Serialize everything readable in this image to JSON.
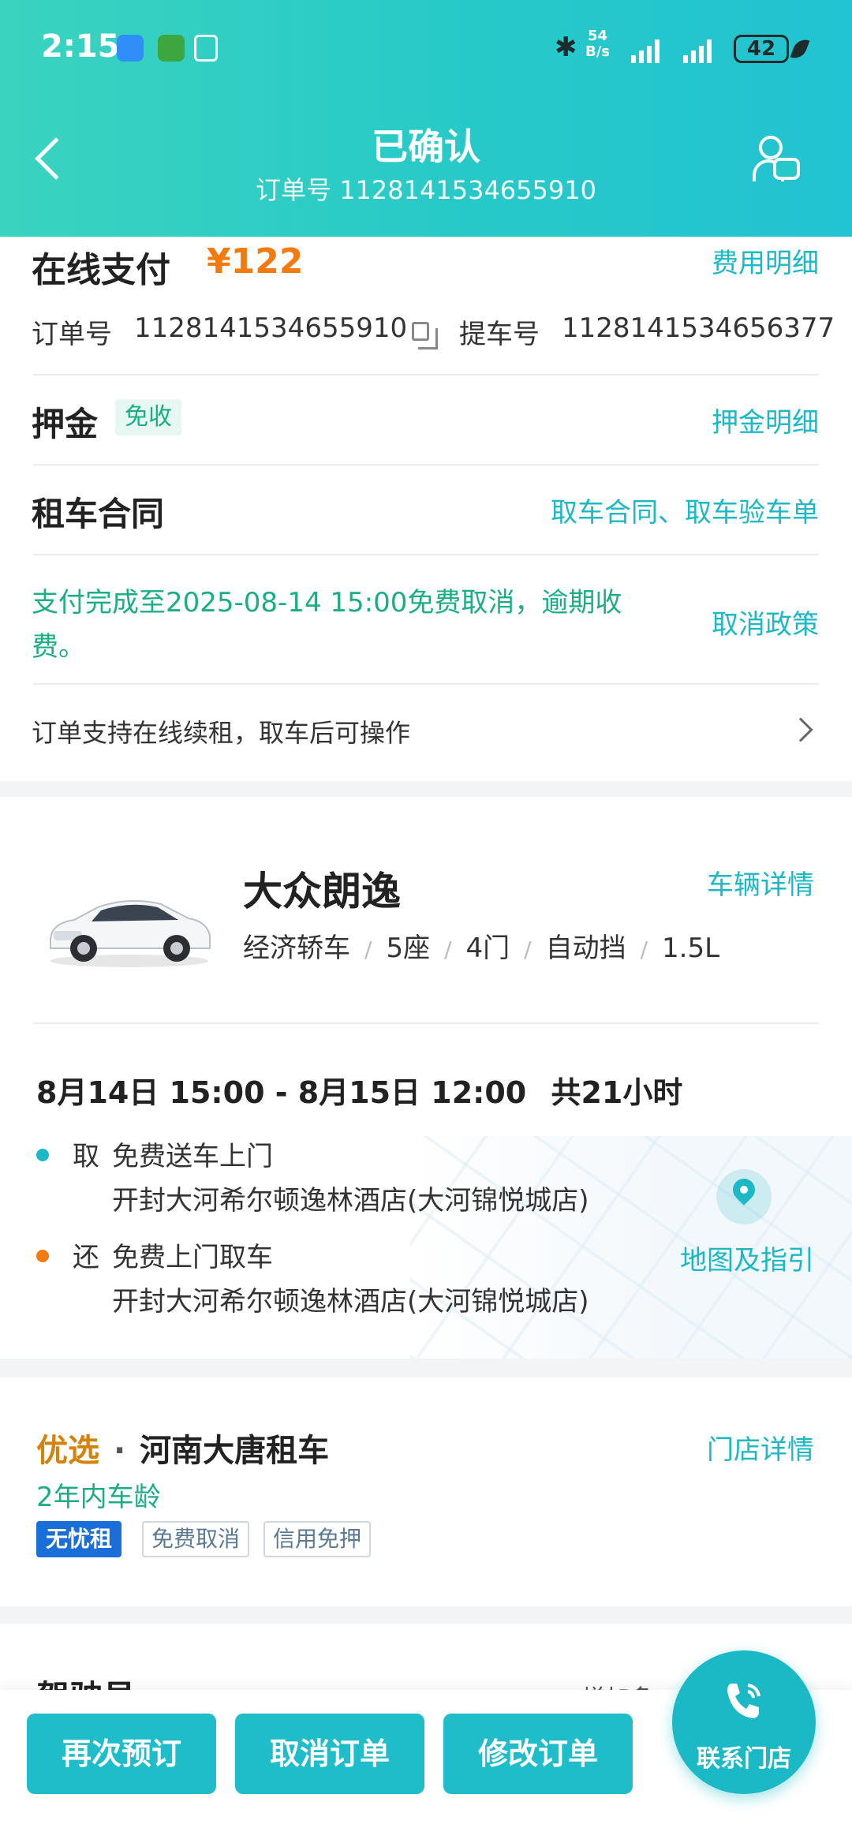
{
  "status_bar": {
    "time": "2:15",
    "net_speed_value": "54",
    "net_speed_unit": "B/s",
    "battery": "42"
  },
  "header": {
    "title": "已确认",
    "subtitle": "订单号 1128141534655910"
  },
  "payment": {
    "label": "在线支付",
    "amount": "¥122",
    "fee_detail_link": "费用明细",
    "order_no_label": "订单号",
    "order_no": "1128141534655910",
    "pickup_no_label": "提车号",
    "pickup_no": "1128141534656377",
    "deposit_label": "押金",
    "deposit_badge": "免收",
    "deposit_detail_link": "押金明细",
    "contract_label": "租车合同",
    "contract_link": "取车合同、取车验车单",
    "cancel_notice_line1": "支付完成至2025-08-14 15:00免费取消，逾期收",
    "cancel_notice_line2": "费。",
    "cancel_policy_link": "取消政策",
    "renew_text": "订单支持在线续租，取车后可操作"
  },
  "car": {
    "name": "大众朗逸",
    "detail_link": "车辆详情",
    "specs": [
      "经济轿车",
      "5座",
      "4门",
      "自动挡",
      "1.5L"
    ],
    "time_range": "8月14日 15:00 - 8月15日 12:00",
    "duration": "共21小时",
    "pickup_tag": "取",
    "pickup_method": "免费送车上门",
    "pickup_address": "开封大河希尔顿逸林酒店(大河锦悦城店)",
    "return_tag": "还",
    "return_method": "免费上门取车",
    "return_address": "开封大河希尔顿逸林酒店(大河锦悦城店)",
    "map_link": "地图及指引"
  },
  "store": {
    "tier": "优选",
    "dot": "·",
    "name": "河南大唐租车",
    "detail_link": "门店详情",
    "car_age": "2年内车龄",
    "tags": [
      "无忧租",
      "免费取消",
      "信用免押"
    ]
  },
  "driver": {
    "title": "驾驶员",
    "add_link": "增加多"
  },
  "actions": {
    "rebook": "再次预订",
    "cancel": "取消订单",
    "modify": "修改订单",
    "contact_store": "联系门店"
  },
  "colors": {
    "accent": "#1bb8c6",
    "price": "#f27a0e",
    "green_text": "#19ae86",
    "header_gradient": [
      "#3ad3bf",
      "#22c3d2"
    ]
  }
}
